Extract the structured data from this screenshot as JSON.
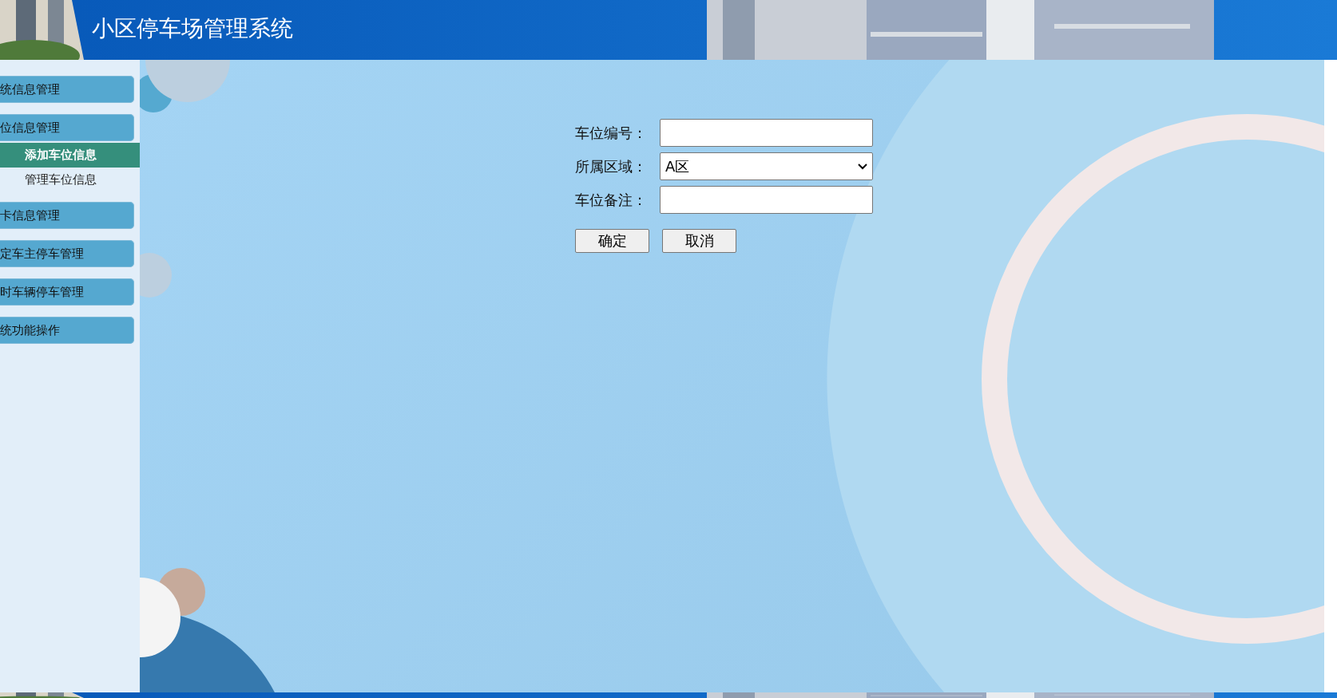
{
  "header": {
    "title": "小区停车场管理系统"
  },
  "sidebar": {
    "groups": [
      {
        "label": "统信息管理"
      },
      {
        "label": "位信息管理",
        "items": [
          {
            "label": "添加车位信息",
            "selected": true
          },
          {
            "label": "管理车位信息",
            "selected": false
          }
        ]
      },
      {
        "label": "卡信息管理"
      },
      {
        "label": "定车主停车管理"
      },
      {
        "label": "时车辆停车管理"
      },
      {
        "label": "统功能操作"
      }
    ]
  },
  "form": {
    "fields": [
      {
        "kind": "text",
        "label": "车位编号："
      },
      {
        "kind": "select",
        "label": "所属区域：",
        "value": "A区"
      },
      {
        "kind": "text",
        "label": "车位备注："
      }
    ],
    "buttons": [
      "确定",
      "取消"
    ]
  }
}
